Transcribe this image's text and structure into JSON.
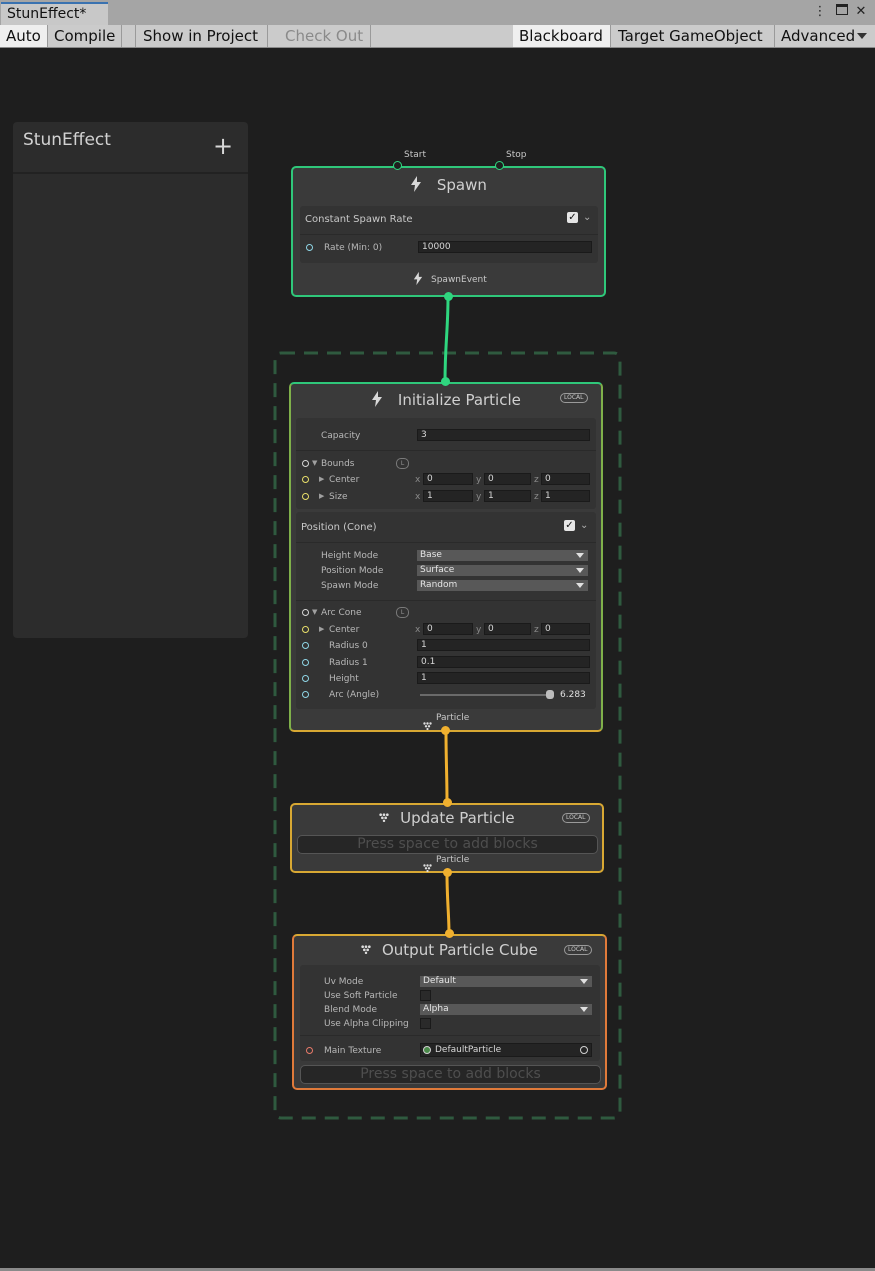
{
  "window": {
    "tab_title": "StunEffect*",
    "icons": [
      "more-vert-icon",
      "maximize-icon",
      "close-icon"
    ]
  },
  "toolbar": {
    "auto": "Auto",
    "compile": "Compile",
    "show_in_project": "Show in Project",
    "check_out": "Check Out",
    "blackboard": "Blackboard",
    "target_gameobject": "Target GameObject",
    "advanced": "Advanced"
  },
  "blackboard": {
    "title": "StunEffect",
    "add": "+"
  },
  "spawn": {
    "title": "Spawn",
    "start": "Start",
    "stop": "Stop",
    "block_title": "Constant Spawn Rate",
    "rate_label": "Rate (Min: 0)",
    "rate_value": "10000",
    "output": "SpawnEvent",
    "color": "#2fc77a"
  },
  "init": {
    "title": "Initialize Particle",
    "badge": "LOCAL",
    "capacity_label": "Capacity",
    "capacity_value": "3",
    "bounds_label": "Bounds",
    "bounds_badge": "L",
    "center_label": "Center",
    "center": {
      "x": "0",
      "y": "0",
      "z": "0"
    },
    "size_label": "Size",
    "size": {
      "x": "1",
      "y": "1",
      "z": "1"
    },
    "output": "Particle",
    "color": "#d8a833"
  },
  "position": {
    "title": "Position (Cone)",
    "height_mode_label": "Height Mode",
    "height_mode": "Base",
    "position_mode_label": "Position Mode",
    "position_mode": "Surface",
    "spawn_mode_label": "Spawn Mode",
    "spawn_mode": "Random",
    "arc_cone_label": "Arc Cone",
    "arc_cone_badge": "L",
    "center_label": "Center",
    "center": {
      "x": "0",
      "y": "0",
      "z": "0"
    },
    "radius0_label": "Radius 0",
    "radius0": "1",
    "radius1_label": "Radius 1",
    "radius1": "0.1",
    "height_label": "Height",
    "height": "1",
    "arc_label": "Arc (Angle)",
    "arc_value": "6.283",
    "arc_fraction": 1.0
  },
  "update": {
    "title": "Update Particle",
    "badge": "LOCAL",
    "placeholder": "Press space to add blocks",
    "output": "Particle",
    "color": "#d8a833"
  },
  "output_node": {
    "title": "Output Particle Cube",
    "badge": "LOCAL",
    "uv_mode_label": "Uv Mode",
    "uv_mode": "Default",
    "soft_label": "Use Soft Particle",
    "blend_label": "Blend Mode",
    "blend": "Alpha",
    "alpha_clip_label": "Use Alpha Clipping",
    "texture_label": "Main Texture",
    "texture": "DefaultParticle",
    "placeholder": "Press space to add blocks",
    "color": "#e07a3a"
  },
  "axes": {
    "x": "x",
    "y": "y",
    "z": "z"
  }
}
